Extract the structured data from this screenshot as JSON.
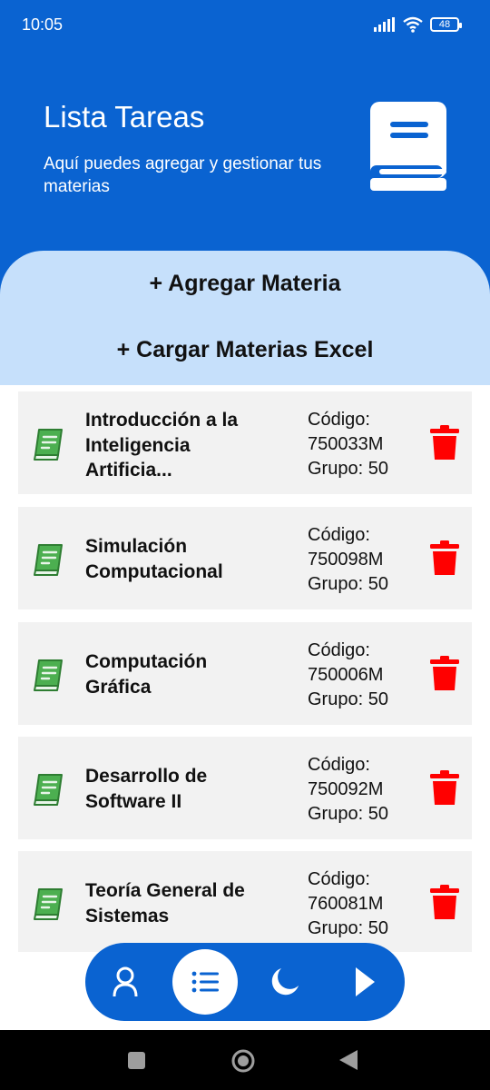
{
  "status_bar": {
    "time": "10:05",
    "battery": "48",
    "icons": [
      "signal-icon",
      "wifi-icon",
      "battery-icon"
    ]
  },
  "header": {
    "title": "Lista Tareas",
    "subtitle": "Aquí puedes agregar y gestionar tus materias",
    "logo_icon": "book-icon"
  },
  "actions": {
    "add_label": "+ Agregar Materia",
    "excel_label": "+ Cargar Materias Excel"
  },
  "subjects": [
    {
      "name": "Introducción a la Inteligencia Artificia...",
      "code_label": "Código:",
      "code": "750033M",
      "group": "Grupo: 50"
    },
    {
      "name": "Simulación Computacional",
      "code_label": "Código:",
      "code": "750098M",
      "group": "Grupo: 50"
    },
    {
      "name": "Computación Gráfica",
      "code_label": "Código:",
      "code": "750006M",
      "group": "Grupo: 50"
    },
    {
      "name": "Desarrollo de Software II",
      "code_label": "Código:",
      "code": "750092M",
      "group": "Grupo: 50"
    },
    {
      "name": "Teoría General de Sistemas",
      "code_label": "Código:",
      "code": "760081M",
      "group": "Grupo: 50"
    }
  ],
  "bottom_nav": {
    "items": [
      "user-icon",
      "list-icon",
      "moon-icon",
      "play-icon"
    ],
    "active": "list-icon"
  },
  "system_nav": [
    "recents-icon",
    "home-icon",
    "back-icon"
  ],
  "colors": {
    "primary": "#0a63d1",
    "actions_bg": "#c6e0fb",
    "card_bg": "#f2f2f2",
    "book_green": "#4caf50",
    "trash_red": "#ff0000"
  }
}
